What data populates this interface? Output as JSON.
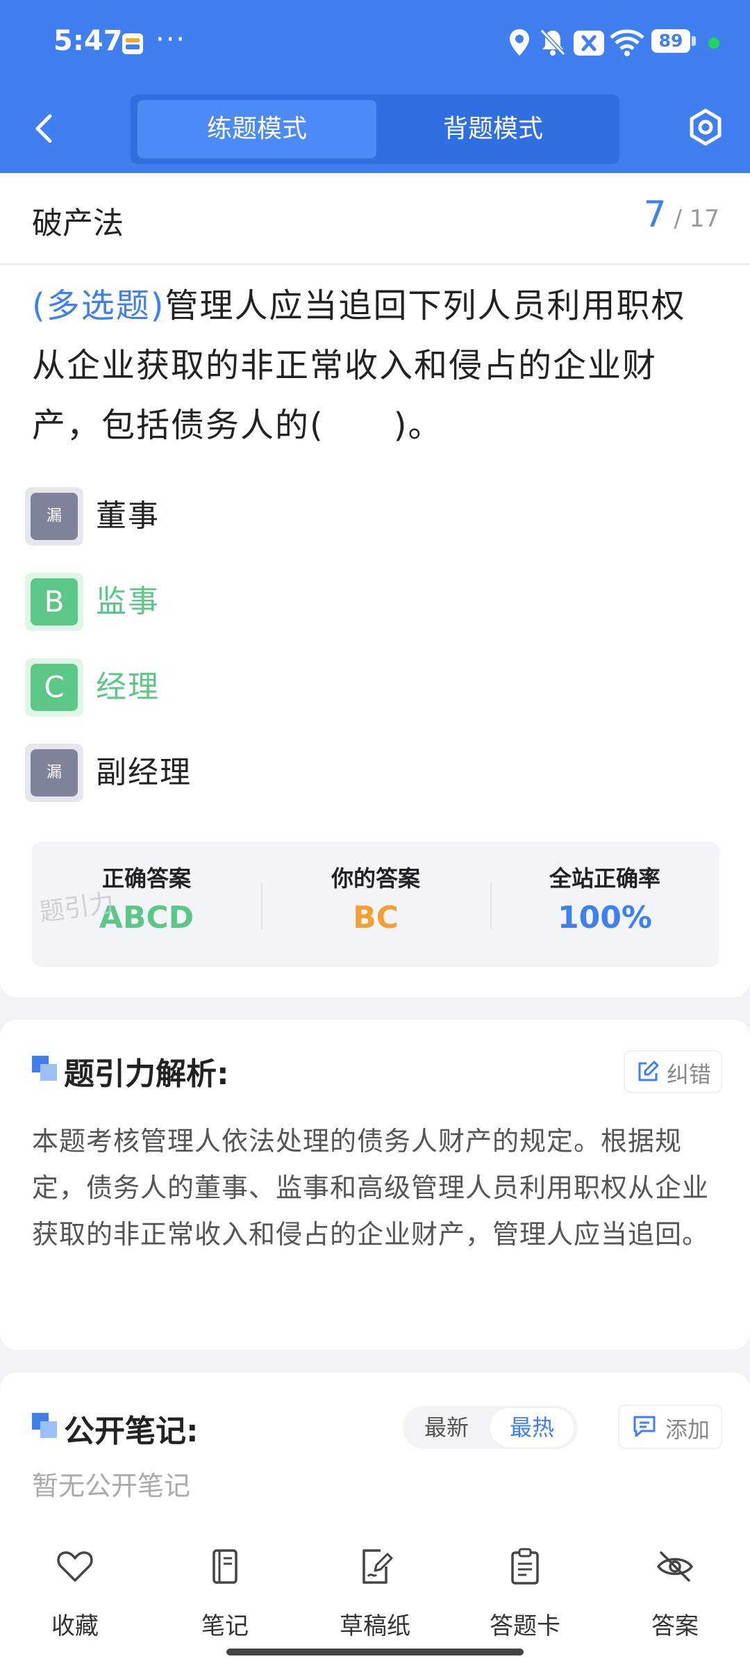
{
  "status_bar": {
    "time": "5:47",
    "more": "···",
    "battery": "89",
    "icons": [
      "wallet-icon",
      "location-icon",
      "bell-off-icon",
      "x-app-icon",
      "wifi-icon",
      "battery-icon"
    ]
  },
  "header": {
    "tabs": [
      {
        "label": "练题模式",
        "active": true
      },
      {
        "label": "背题模式",
        "active": false
      }
    ],
    "colors": {
      "header_bg": "#3f7ff0",
      "accent": "#3f7ff0",
      "correct": "#5cc786",
      "user_answer": "#f0a035"
    }
  },
  "question": {
    "chapter": "破产法",
    "current": "7",
    "total": "/ 17",
    "type": "(多选题)",
    "text": "管理人应当追回下列人员利用职权从企业获取的非正常收入和侵占的企业财产，包括债务人的(　　)。",
    "options": [
      {
        "badge": "漏",
        "text": "董事",
        "state": "missed"
      },
      {
        "badge": "B",
        "text": "监事",
        "state": "correct"
      },
      {
        "badge": "C",
        "text": "经理",
        "state": "correct"
      },
      {
        "badge": "漏",
        "text": "副经理",
        "state": "missed"
      }
    ]
  },
  "stats": {
    "watermark": "题引力",
    "correct_answer_label": "正确答案",
    "correct_answer": "ABCD",
    "your_answer_label": "你的答案",
    "your_answer": "BC",
    "site_rate_label": "全站正确率",
    "site_rate": "100%"
  },
  "analysis": {
    "title": "题引力解析:",
    "report_label": "纠错",
    "text": "本题考核管理人依法处理的债务人财产的规定。根据规定，债务人的董事、监事和高级管理人员利用职权从企业获取的非正常收入和侵占的企业财产，管理人应当追回。"
  },
  "notes": {
    "title": "公开笔记:",
    "sort_latest": "最新",
    "sort_hot": "最热",
    "add_label": "添加",
    "empty": "暂无公开笔记"
  },
  "bottom_nav": [
    {
      "label": "收藏",
      "icon": "heart-icon"
    },
    {
      "label": "笔记",
      "icon": "notebook-icon"
    },
    {
      "label": "草稿纸",
      "icon": "draft-icon"
    },
    {
      "label": "答题卡",
      "icon": "clipboard-icon"
    },
    {
      "label": "答案",
      "icon": "eye-off-icon"
    }
  ]
}
